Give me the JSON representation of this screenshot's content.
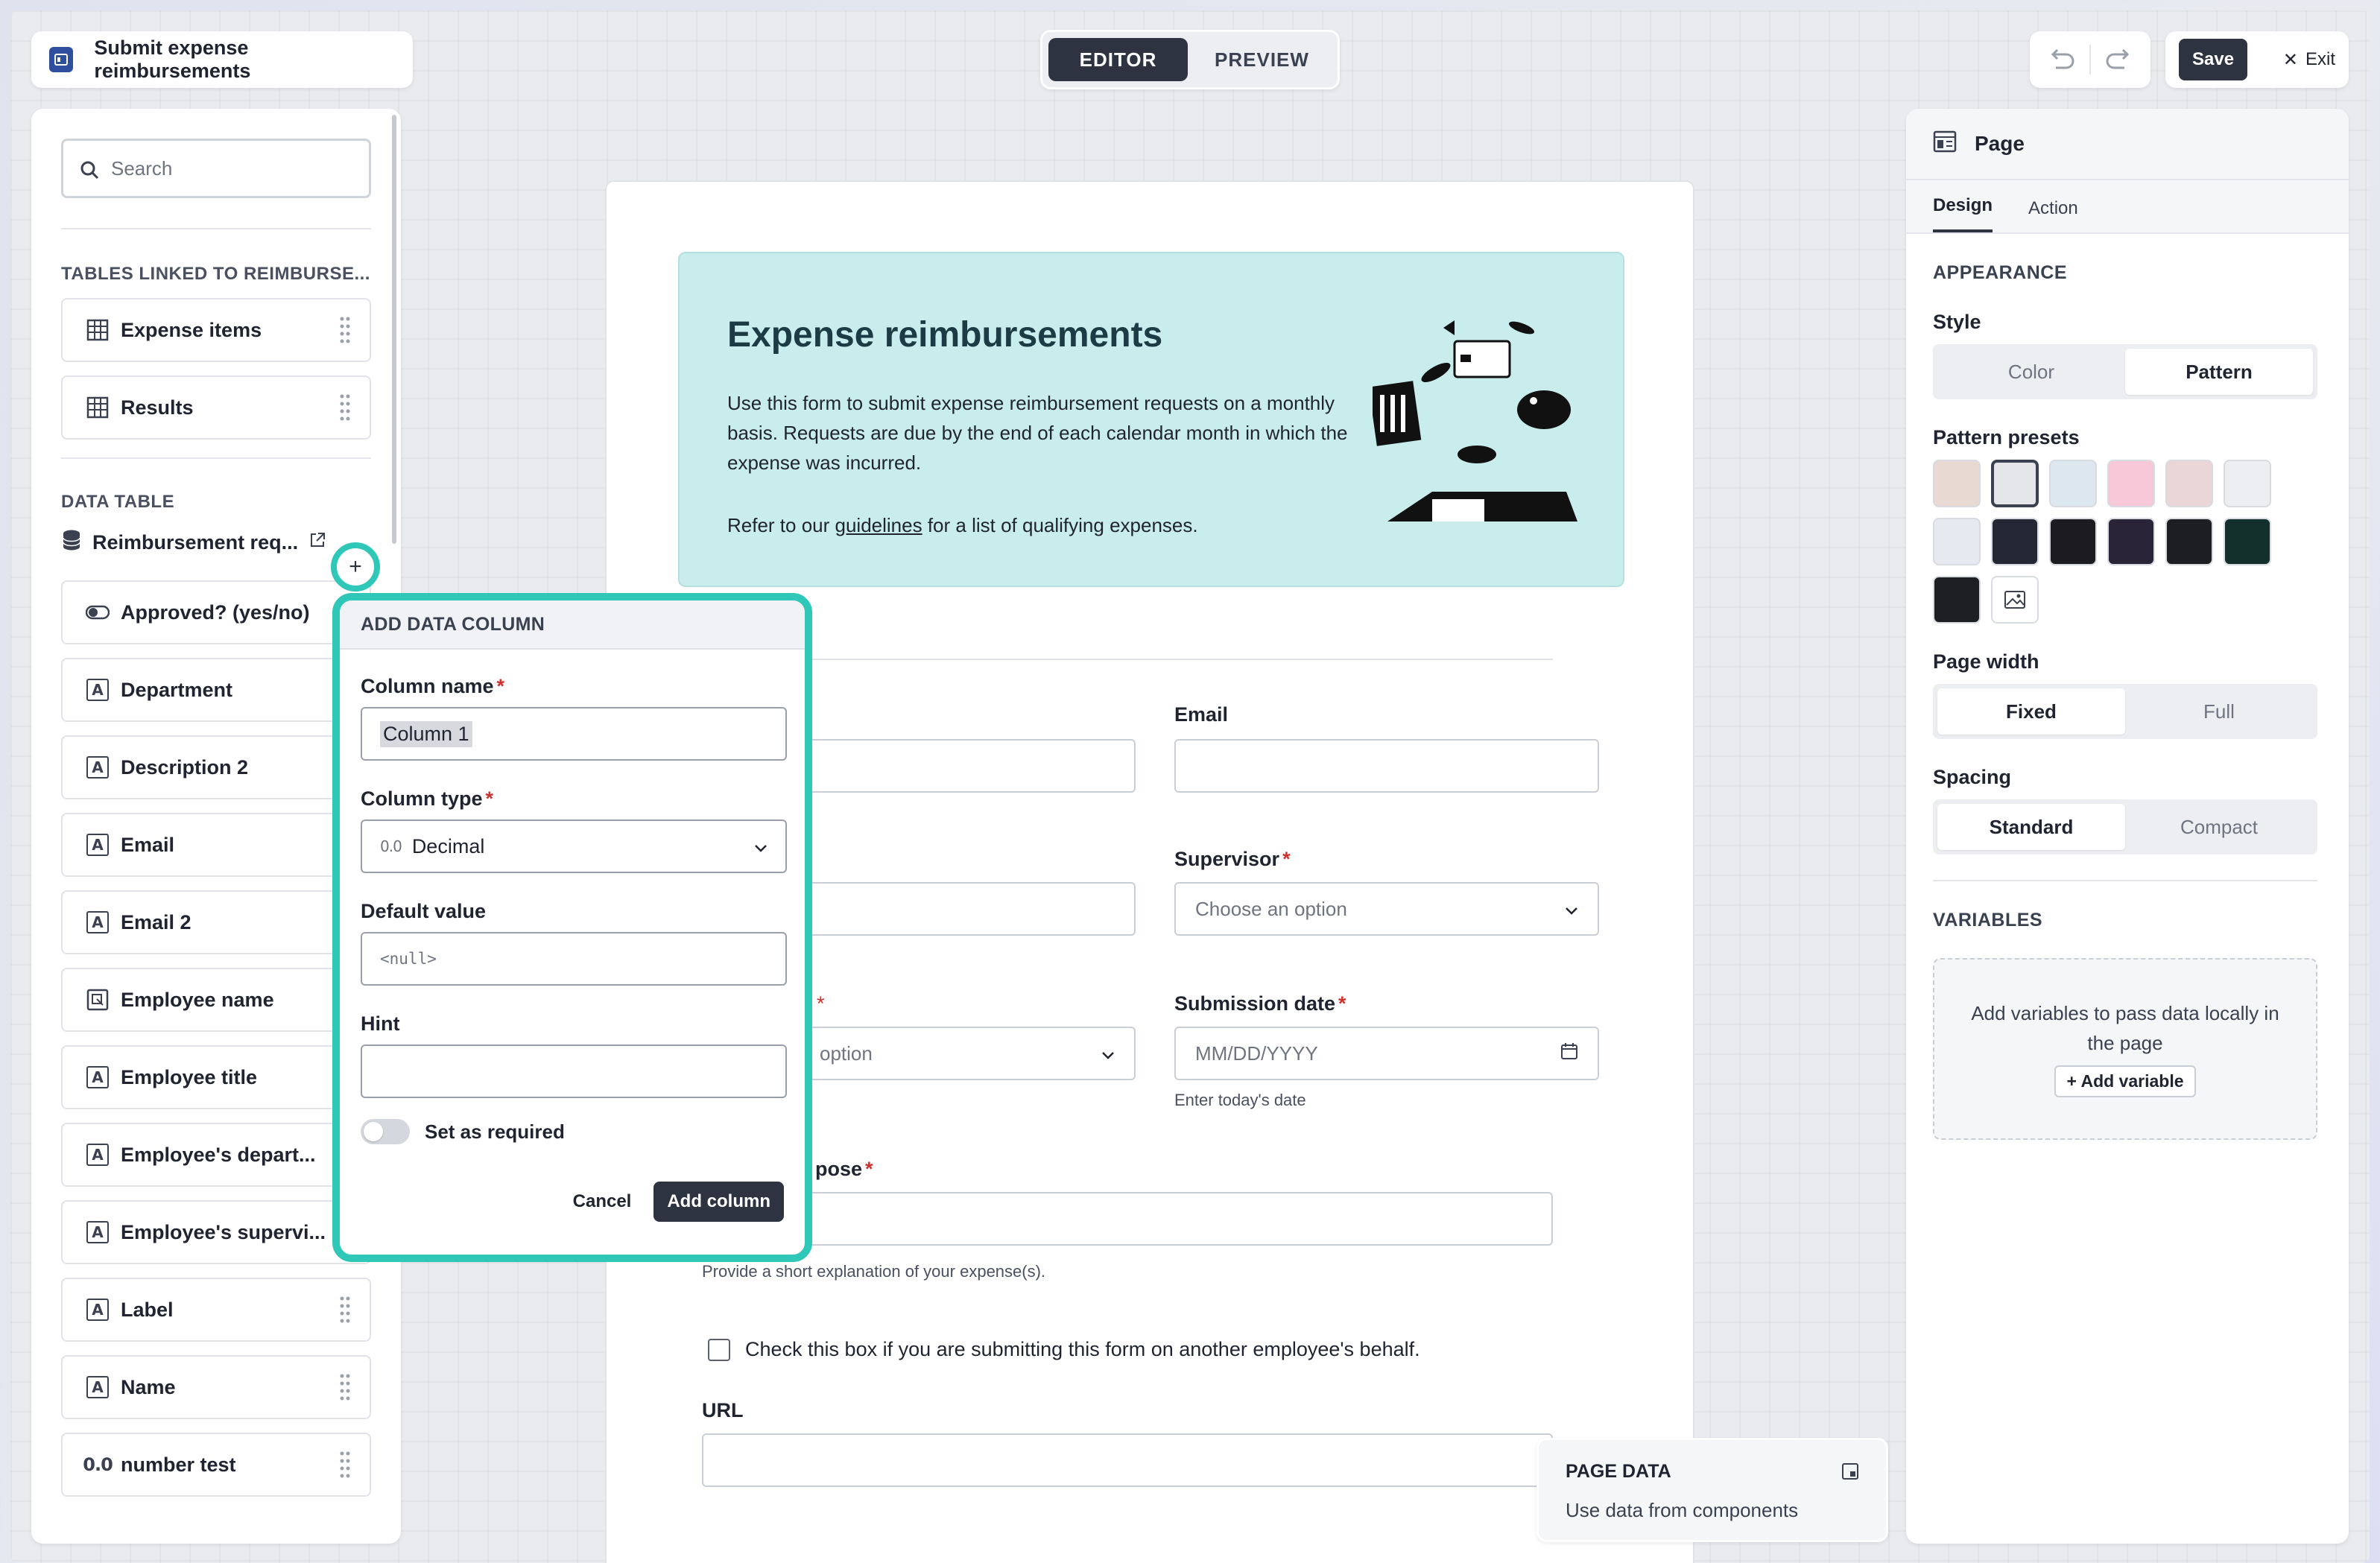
{
  "header": {
    "app_title": "Submit expense reimbursements",
    "modes": [
      {
        "label": "EDITOR",
        "active": true
      },
      {
        "label": "PREVIEW",
        "active": false
      }
    ],
    "save_label": "Save",
    "exit_label": "Exit"
  },
  "sidebar": {
    "search_placeholder": "Search",
    "linked_section": "TABLES LINKED TO REIMBURSE...",
    "linked_tables": [
      {
        "label": "Expense items",
        "icon": "table-icon"
      },
      {
        "label": "Results",
        "icon": "table-icon"
      }
    ],
    "data_table_section": "DATA TABLE",
    "data_table_name": "Reimbursement req...",
    "columns": [
      {
        "label": "Approved? (yes/no)",
        "type": "toggle"
      },
      {
        "label": "Department",
        "type": "text"
      },
      {
        "label": "Description 2",
        "type": "text"
      },
      {
        "label": "Email",
        "type": "text"
      },
      {
        "label": "Email 2",
        "type": "text"
      },
      {
        "label": "Employee name",
        "type": "link"
      },
      {
        "label": "Employee title",
        "type": "text"
      },
      {
        "label": "Employee's depart...",
        "type": "text"
      },
      {
        "label": "Employee's supervi...",
        "type": "text"
      },
      {
        "label": "Label",
        "type": "text"
      },
      {
        "label": "Name",
        "type": "text"
      },
      {
        "label": "number test",
        "type": "decimal"
      }
    ],
    "type_glyphs": {
      "text": "A",
      "decimal": "0.0"
    }
  },
  "canvas": {
    "banner": {
      "title": "Expense reimbursements",
      "body": "Use this form to submit expense reimbursement requests on a monthly basis. Requests are due by the end of each calendar month in which the expense was incurred.",
      "ref_prefix": "Refer to our ",
      "ref_link": "guidelines",
      "ref_suffix": " for a list of qualifying expenses."
    },
    "email_label": "Email",
    "supervisor_label": "Supervisor",
    "supervisor_placeholder": "Choose an option",
    "left_select_partial": "option",
    "submission_label": "Submission date",
    "submission_placeholder": "MM/DD/YYYY",
    "submission_hint": "Enter today's date",
    "purpose_label_partial": "pose",
    "purpose_hint": "Provide a short explanation of your expense(s).",
    "behalf_checkbox": "Check this box if you are submitting this form on another employee's behalf.",
    "url_label": "URL"
  },
  "popup": {
    "title": "ADD DATA COLUMN",
    "name_label": "Column name",
    "name_value": "Column 1",
    "type_label": "Column type",
    "type_glyph": "0.0",
    "type_value": "Decimal",
    "default_label": "Default value",
    "default_value": "<null>",
    "hint_label": "Hint",
    "hint_value": "",
    "required_label": "Set as required",
    "cancel_label": "Cancel",
    "submit_label": "Add column",
    "accent": "#2ec7b8"
  },
  "right_panel": {
    "title": "Page",
    "tabs": [
      {
        "label": "Design",
        "active": true
      },
      {
        "label": "Action",
        "active": false
      }
    ],
    "appearance_section": "APPEARANCE",
    "style_label": "Style",
    "style_options": [
      {
        "label": "Color",
        "active": false
      },
      {
        "label": "Pattern",
        "active": true
      }
    ],
    "presets_label": "Pattern presets",
    "swatches": [
      "#e8d9d2",
      "#e4e6ea",
      "#dde7ef",
      "#f7c8d8",
      "#ead6d6",
      "#eceef2",
      "#e6eaf0",
      "#262735",
      "#1c1b20",
      "#2a2438",
      "#1c1e22",
      "#14302d",
      "#1d1f22"
    ],
    "width_label": "Page width",
    "width_options": [
      {
        "label": "Fixed",
        "active": true
      },
      {
        "label": "Full",
        "active": false
      }
    ],
    "spacing_label": "Spacing",
    "spacing_options": [
      {
        "label": "Standard",
        "active": true
      },
      {
        "label": "Compact",
        "active": false
      }
    ],
    "variables_section": "VARIABLES",
    "variables_text": "Add variables to pass data locally in the page",
    "add_variable_label": "+ Add variable"
  },
  "page_data_card": {
    "title": "PAGE DATA",
    "subtitle": "Use data from components"
  }
}
